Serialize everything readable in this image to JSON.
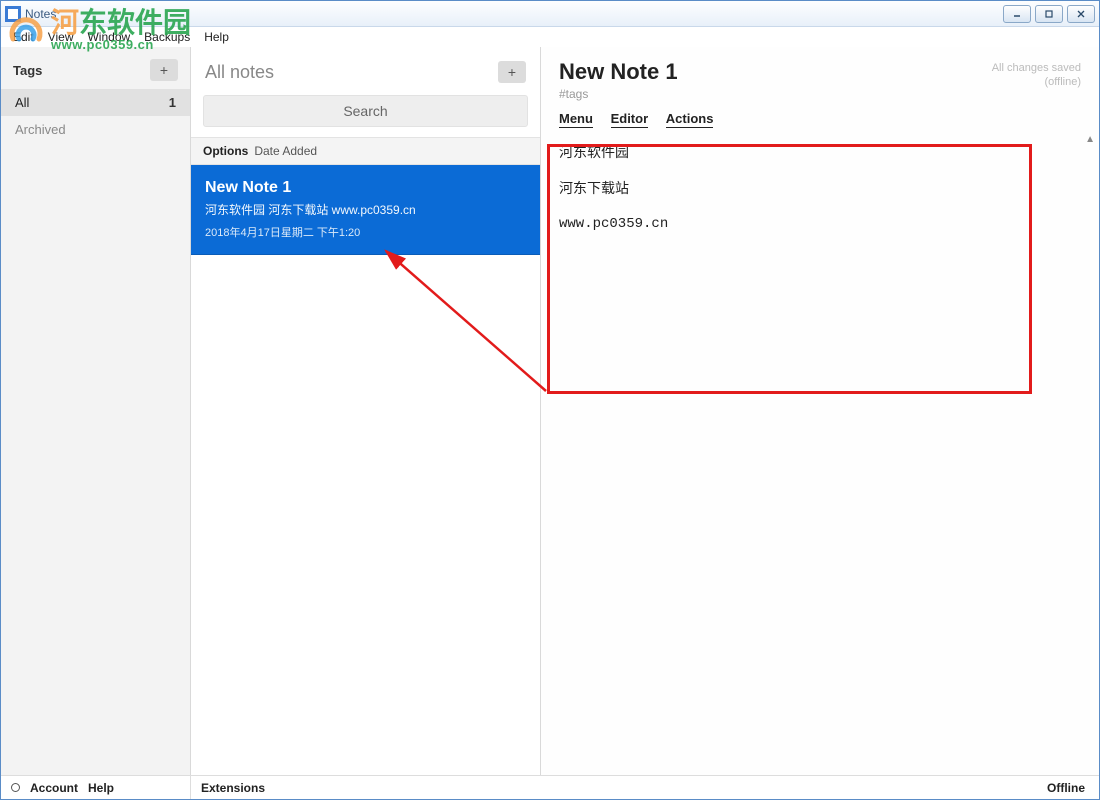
{
  "window": {
    "title": "Notes"
  },
  "menubar": [
    "Edit",
    "View",
    "Window",
    "Backups",
    "Help"
  ],
  "tags": {
    "header": "Tags",
    "items": [
      {
        "label": "All",
        "count": "1",
        "active": true
      },
      {
        "label": "Archived",
        "count": "",
        "active": false
      }
    ]
  },
  "notes": {
    "header": "All notes",
    "search_label": "Search",
    "options_label": "Options",
    "sort_label": "Date Added",
    "list": [
      {
        "title": "New Note 1",
        "preview": "河东软件园 河东下载站 www.pc0359.cn",
        "date": "2018年4月17日星期二 下午1:20"
      }
    ]
  },
  "editor": {
    "title": "New Note 1",
    "tags_placeholder": "#tags",
    "save_status_line1": "All changes saved",
    "save_status_line2": "(offline)",
    "tabs": [
      "Menu",
      "Editor",
      "Actions"
    ],
    "body": {
      "line1": "河东软件园",
      "line2": "河东下载站",
      "line3": "www.pc0359.cn"
    }
  },
  "footer": {
    "account": "Account",
    "help": "Help",
    "extensions": "Extensions",
    "offline": "Offline"
  },
  "watermark": {
    "text": "河东软件园",
    "url": "www.pc0359.cn"
  }
}
